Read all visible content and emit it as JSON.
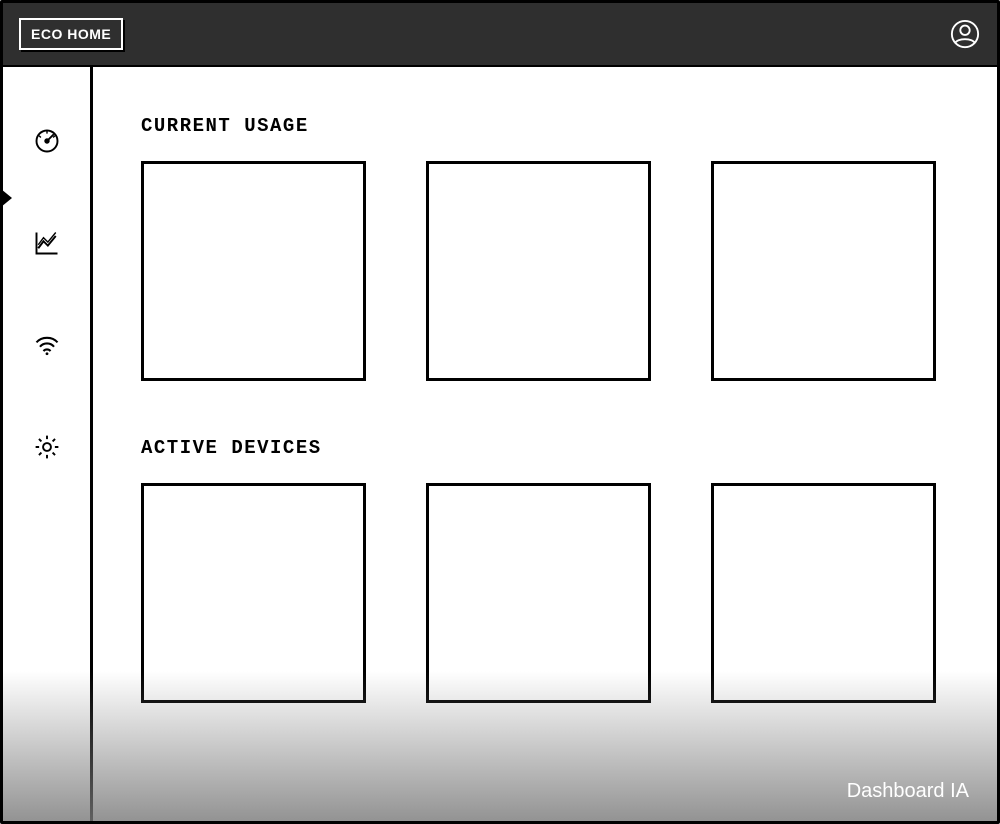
{
  "header": {
    "logo_label": "ECO HOME"
  },
  "sidebar": {
    "items": [
      {
        "icon": "gauge-icon"
      },
      {
        "icon": "chart-line-icon"
      },
      {
        "icon": "wifi-icon"
      },
      {
        "icon": "gear-icon"
      }
    ]
  },
  "main": {
    "sections": [
      {
        "heading": "CURRENT USAGE"
      },
      {
        "heading": "ACTIVE DEVICES"
      }
    ]
  },
  "footer": {
    "label": "Dashboard IA"
  }
}
